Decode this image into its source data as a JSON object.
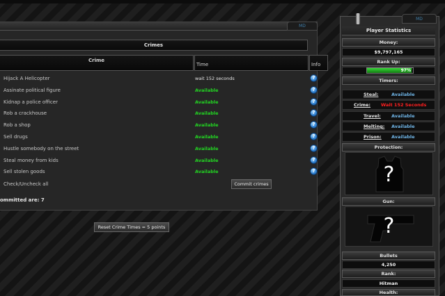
{
  "tabs": {
    "main_md": "MD",
    "side_md": "MD"
  },
  "crimes": {
    "title": "Crimes",
    "headers": {
      "crime": "Crime",
      "time": "Time",
      "info": "Info"
    },
    "rows": [
      {
        "name": "Hijack A Helicopter",
        "time": "wait 152 seconds",
        "status": "wait"
      },
      {
        "name": "Assinate political figure",
        "time": "Available",
        "status": "available"
      },
      {
        "name": "Kidnap a police officer",
        "time": "Available",
        "status": "available"
      },
      {
        "name": "Rob a crackhouse",
        "time": "Available",
        "status": "available"
      },
      {
        "name": "Rob a shop",
        "time": "Available",
        "status": "available"
      },
      {
        "name": "Sell drugs",
        "time": "Available",
        "status": "available"
      },
      {
        "name": "Hustle somebody on the street",
        "time": "Available",
        "status": "available"
      },
      {
        "name": "Steal money from kids",
        "time": "Available",
        "status": "available"
      },
      {
        "name": "Sell stolen goods",
        "time": "Available",
        "status": "available"
      }
    ],
    "info_icon_glyph": "?",
    "check_all": "Check/Uncheck all",
    "commit_button": "Commit crimes",
    "committed_text": "ommitted are: 7",
    "reset_button": "Reset Crime Times = 5 points"
  },
  "sidebar": {
    "title": "Player Statistics",
    "money_label": "Money:",
    "money_value": "$9,797,165",
    "rankup_label": "Rank Up:",
    "rankup_percent_text": "97%",
    "rankup_fraction": 0.97,
    "timers_label": "Timers:",
    "timers": [
      {
        "label": "Steal:",
        "value": "Available",
        "status": "available"
      },
      {
        "label": "Crime:",
        "value": "Wait 152 Seconds",
        "status": "wait"
      },
      {
        "label": "Travel:",
        "value": "Available",
        "status": "available"
      },
      {
        "label": "Melting:",
        "value": "Available",
        "status": "available"
      },
      {
        "label": "Prison:",
        "value": "Available",
        "status": "available"
      }
    ],
    "protection_label": "Protection:",
    "protection_glyph": "?",
    "gun_label": "Gun:",
    "gun_glyph": "?",
    "bullets_label": "Bullets",
    "bullets_value": "4,250",
    "rank_label": "Rank:",
    "rank_value": "Hitman",
    "cutoff_label": "Health:"
  },
  "colors": {
    "available": "#22d822",
    "wait_red": "#ff1f1f",
    "timer_blue": "#6fb4e6"
  }
}
